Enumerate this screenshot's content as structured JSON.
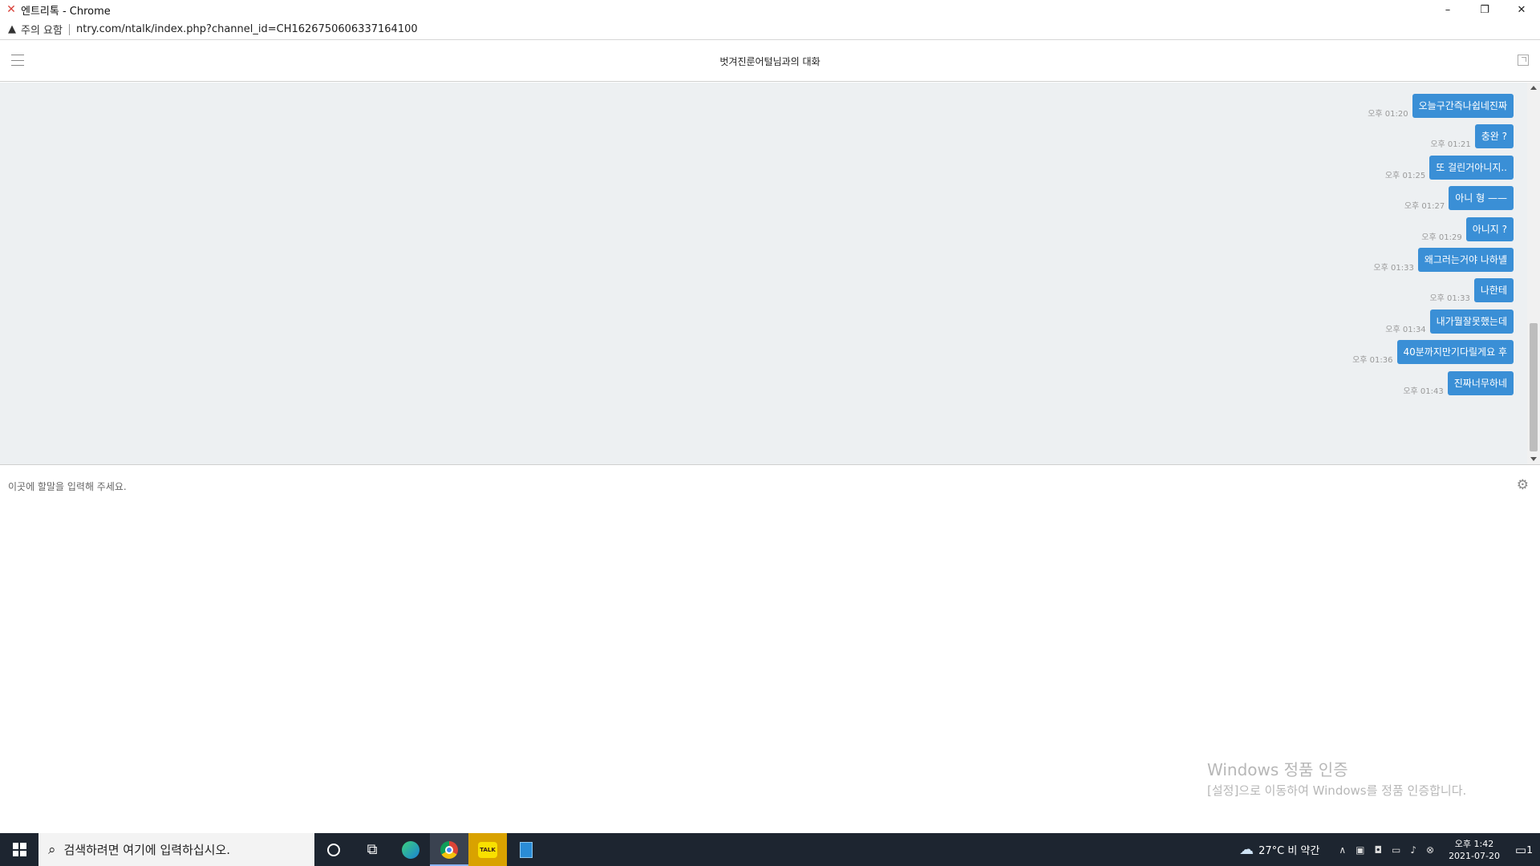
{
  "window": {
    "title": "엔트리톡 - Chrome",
    "minimize": "–",
    "restore": "❐",
    "close": "✕"
  },
  "address_bar": {
    "warning": "주의 요함",
    "url": "ntry.com/ntalk/index.php?channel_id=CH1626750606337164100"
  },
  "chat": {
    "title": "벗겨진룬어털님과의 대화",
    "input_placeholder": "이곳에 할말을 입력해 주세요.",
    "messages": [
      {
        "time": "오후 01:20",
        "text": "오늘구간즉나쉽네진짜"
      },
      {
        "time": "오후 01:21",
        "text": "충완 ?"
      },
      {
        "time": "오후 01:25",
        "text": "또 걸린거아니지.."
      },
      {
        "time": "오후 01:27",
        "text": "아니 형 ——"
      },
      {
        "time": "오후 01:29",
        "text": "아니지 ?"
      },
      {
        "time": "오후 01:33",
        "text": "왜그러는거야 나하녤"
      },
      {
        "time": "오후 01:33",
        "text": "나한테"
      },
      {
        "time": "오후 01:34",
        "text": "내가뭘잘못했는데"
      },
      {
        "time": "오후 01:36",
        "text": "40분까지만기다릴게요 후"
      },
      {
        "time": "오후 01:43",
        "text": "진짜너무하네"
      }
    ]
  },
  "watermark": {
    "title": "Windows 정품 인증",
    "subtitle": "[설정]으로 이동하여 Windows를 정품 인증합니다."
  },
  "taskbar": {
    "search_placeholder": "검색하려면 여기에 입력하십시오.",
    "kakao_label": "TALK",
    "weather": "27°C  비 약간",
    "time": "오후 1:42",
    "date": "2021-07-20",
    "notification_count": "1"
  },
  "colors": {
    "bubble": "#3a8fd6",
    "chat_bg": "#edf0f2",
    "taskbar_bg": "#1d2530"
  }
}
